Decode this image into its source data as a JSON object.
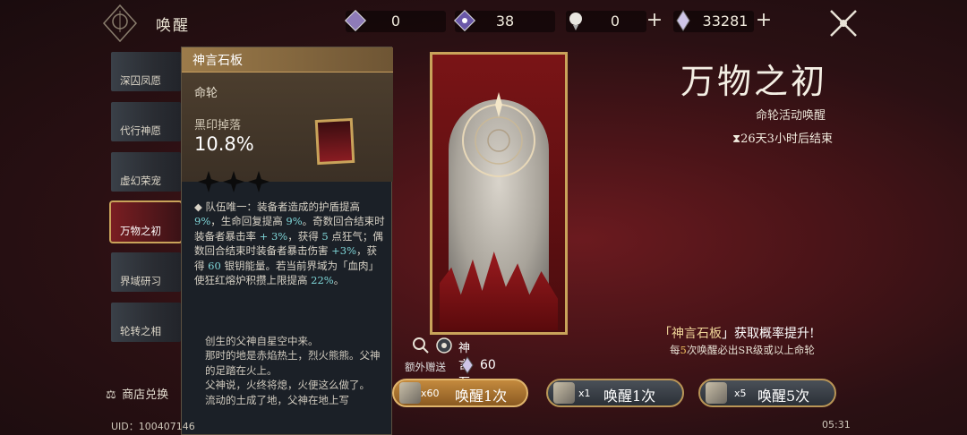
{
  "header": {
    "title": "唤醒",
    "currencies": [
      {
        "icon": "purple-gem-icon",
        "value": "0"
      },
      {
        "icon": "purple-crystal-icon",
        "value": "38"
      },
      {
        "icon": "white-orb-icon",
        "value": "0"
      },
      {
        "icon": "shard-icon",
        "value": "33281"
      }
    ],
    "plus_glyph": "+"
  },
  "sidebar": {
    "items": [
      {
        "label": "深囚凤愿"
      },
      {
        "label": "代行神愿"
      },
      {
        "label": "虚幻荣宠"
      },
      {
        "label": "万物之初",
        "active": true
      },
      {
        "label": "界域研习"
      },
      {
        "label": "轮转之相"
      }
    ],
    "shop_label": "商店兑换"
  },
  "tooltip": {
    "title": "神言石板",
    "type": "命轮",
    "drop_label": "黑印掉落",
    "drop_rate": "10.8%",
    "desc_parts": [
      "队伍唯一：装备者造成的护盾提高 ",
      "9%",
      "，生命回复提高 ",
      "9%",
      "。奇数回合结束时装备者暴击率 ",
      "+ 3%",
      "，获得 ",
      "5",
      " 点狂气；偶数回合结束时装备者暴击伤害 ",
      "+3%",
      "，获得 ",
      "60",
      " 银钥能量。若当前界域为「血肉」使狂红熔炉积攒上限提高 ",
      "22%",
      "。"
    ],
    "lore": "创生的父神自星空中来。\n那时的地是赤焰热土，烈火熊熊。父神的足踏在火上。\n父神说，火终将熄，火便这么做了。\n流动的土成了地，父神在地上写"
  },
  "card": {
    "name": "神言石板",
    "extra_label": "额外赠送",
    "extra_count": "60"
  },
  "banner": {
    "title": "万物之初",
    "subtitle": "命轮活动唤醒",
    "timer": "⧗26天3小时后结束",
    "promo_pre": "「",
    "promo_item": "神言石板",
    "promo_post": "」获取概率提升!",
    "guarantee_pre": "每",
    "guarantee_num": "5",
    "guarantee_post": "次唤醒必出SR级或以上命轮"
  },
  "buttons": [
    {
      "count": "x60",
      "label": "唤醒1次",
      "style": "gold"
    },
    {
      "count": "x1",
      "label": "唤醒1次",
      "style": "gray"
    },
    {
      "count": "x5",
      "label": "唤醒5次",
      "style": "gray"
    }
  ],
  "footer": {
    "uid": "UID：100407146",
    "time": "05:31"
  },
  "colors": {
    "accent_gold": "#c9a35a",
    "highlight_cyan": "#7fd6d8",
    "bg_red": "#4a1418"
  }
}
